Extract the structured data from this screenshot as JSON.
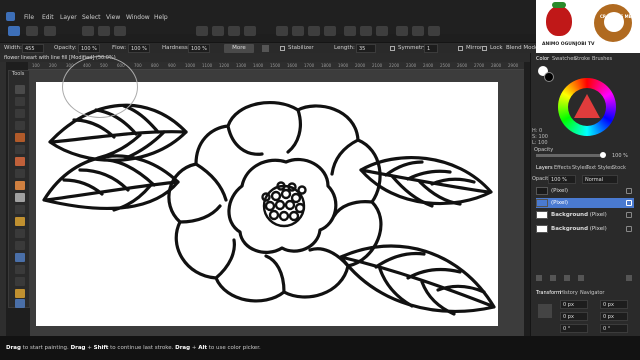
{
  "menu": [
    "File",
    "Edit",
    "Layer",
    "Select",
    "View",
    "Window",
    "Help"
  ],
  "context": {
    "width_label": "Width:",
    "width_value": "455 px",
    "opacity_label": "Opacity:",
    "opacity_value": "100 %",
    "flow_label": "Flow:",
    "flow_value": "100 %",
    "hardness_label": "Hardness:",
    "hardness_value": "100 %",
    "more_label": "More",
    "stabilizer_label": "Stabilizer",
    "length_label": "Length:",
    "length_value": "35",
    "symmetry_label": "Symmetry",
    "symmetry_value": "1",
    "mirror_label": "Mirror",
    "lock_label": "Lock",
    "blendmode_label": "Blend Mode:"
  },
  "document": {
    "title": "flower lineart with line fill [Modified] (50.0%)"
  },
  "ruler_ticks": [
    "100",
    "200",
    "300",
    "400",
    "500",
    "600",
    "700",
    "800",
    "900",
    "1000",
    "1100",
    "1200",
    "1300",
    "1400",
    "1500",
    "1600",
    "1700",
    "1800",
    "1900",
    "2000",
    "2100",
    "2200",
    "2300",
    "2400",
    "2500",
    "2600",
    "2700",
    "2800",
    "2900"
  ],
  "tools_label": "Tools",
  "panels": {
    "top_tabs": [
      "Color",
      "Swatches",
      "Stroke",
      "Brushes"
    ],
    "hsl": {
      "h": "H: 0",
      "s": "S: 100",
      "l": "L: 100"
    },
    "opacity_label": "Opacity",
    "opacity_value": "100 %",
    "layer_tabs": [
      "Layers",
      "Effects",
      "Styles",
      "Text Styles",
      "Stock"
    ],
    "layer_opacity_label": "Opacity:",
    "layer_opacity_value": "100 %",
    "layer_blend": "Normal",
    "layers": [
      {
        "name": "(Pixel)",
        "selected": false,
        "bold": false
      },
      {
        "name": "(Pixel)",
        "selected": true,
        "bold": false
      },
      {
        "name": "Background",
        "suffix": " (Pixel)",
        "selected": false,
        "bold": true
      },
      {
        "name": "Background",
        "suffix": " (Pixel)",
        "selected": false,
        "bold": true
      }
    ],
    "bottom_tabs": [
      "Transform",
      "History",
      "Navigator"
    ],
    "transform_fields": [
      "0 px",
      "0 px",
      "0 px",
      "0 px",
      "0 °",
      "0 °"
    ]
  },
  "logo": {
    "left_text": "ANIMO OGUNJOBI TV",
    "right_text": "CRAFTERS MEDIA"
  },
  "status": {
    "k1": "Drag",
    "t1": " to start painting. ",
    "k2": "Drag",
    "t2": " + ",
    "k3": "Shift",
    "t3": " to continue last stroke. ",
    "k4": "Drag",
    "t4": " + ",
    "k5": "Alt",
    "t5": " to use color picker."
  },
  "colors": {
    "accent": "#3d6fb8",
    "wheel": "#e03c3c",
    "selected_layer": "#4a7ad0"
  }
}
